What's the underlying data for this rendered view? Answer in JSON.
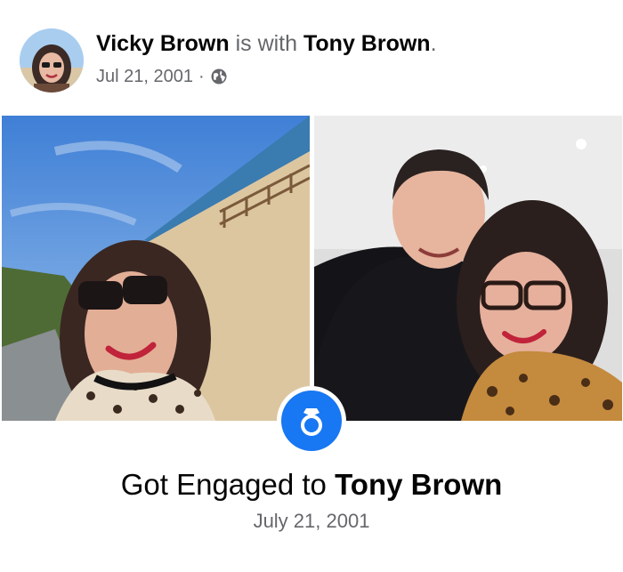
{
  "post": {
    "author": "Vicky Brown",
    "with_text": "is with",
    "tagged": "Tony Brown",
    "period": ".",
    "date": "Jul 21, 2001",
    "separator": "·",
    "privacy_icon": "globe-icon"
  },
  "photos": [
    {
      "name": "photo-beach-selfie",
      "description_icon": "photo"
    },
    {
      "name": "photo-couple",
      "description_icon": "photo"
    }
  ],
  "life_event": {
    "icon": "ring-icon",
    "title_prefix": "Got Engaged to",
    "title_person": "Tony Brown",
    "date": "July 21, 2001"
  },
  "colors": {
    "accent": "#1877f2",
    "text_primary": "#050505",
    "text_secondary": "#65676b"
  }
}
